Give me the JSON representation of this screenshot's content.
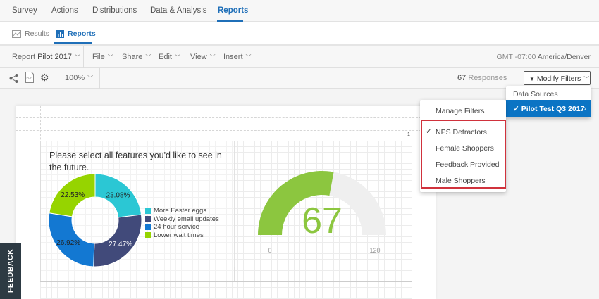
{
  "top_nav": {
    "tabs": [
      {
        "label": "Survey"
      },
      {
        "label": "Actions"
      },
      {
        "label": "Distributions"
      },
      {
        "label": "Data & Analysis"
      },
      {
        "label": "Reports",
        "active": true
      }
    ]
  },
  "sub_nav": {
    "results": "Results",
    "reports": "Reports"
  },
  "toolbar": {
    "report_prefix": "Report",
    "report_name": "Pilot 2017",
    "menus": [
      "File",
      "Share",
      "Edit",
      "View",
      "Insert"
    ],
    "timezone_prefix": "GMT -07:00",
    "timezone": "America/Denver",
    "zoom": "100%",
    "responses_count": "67",
    "responses_label": "Responses",
    "modify_filters": "Modify Filters"
  },
  "data_sources_menu": {
    "header": "Data Sources",
    "selected": "Pilot Test Q3 2017"
  },
  "filters_menu": {
    "manage": "Manage Filters",
    "items": [
      {
        "label": "NPS Detractors",
        "checked": true
      },
      {
        "label": "Female Shoppers"
      },
      {
        "label": "Feedback Provided"
      },
      {
        "label": "Male Shoppers"
      }
    ]
  },
  "page_number": "1",
  "chart_data": [
    {
      "type": "pie",
      "title": "Please select all features you'd like to see in the future.",
      "categories": [
        "More Easter eggs ...",
        "Weekly email updates",
        "24 hour service",
        "Lower wait times"
      ],
      "values": [
        23.08,
        27.47,
        26.92,
        22.53
      ],
      "labels": [
        "23.08%",
        "27.47%",
        "26.92%",
        "22.53%"
      ],
      "colors": [
        "#2bc7d4",
        "#414a7a",
        "#1378d2",
        "#96d400"
      ],
      "donut": true,
      "legend": "right"
    },
    {
      "type": "gauge",
      "value": 67,
      "value_label": "67",
      "min": 0,
      "max": 120,
      "min_label": "0",
      "max_label": "120",
      "color": "#8cc63f",
      "track": "#efefef"
    }
  ],
  "feedback": "FEEDBACK",
  "colors": {
    "accent": "#1f6fb8",
    "highlight": "#0b74c4",
    "red_outline": "#d0323c"
  }
}
